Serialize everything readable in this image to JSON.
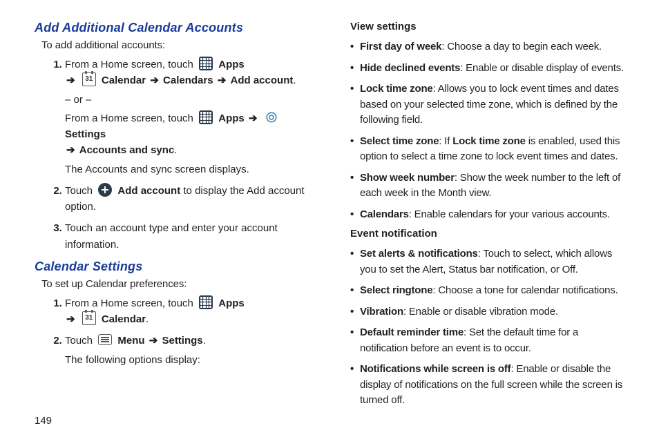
{
  "page_number": "149",
  "left": {
    "section1": {
      "heading": "Add Additional Calendar Accounts",
      "intro": "To add additional accounts:",
      "step1_a": "From a Home screen, touch",
      "apps": "Apps",
      "calendar": "Calendar",
      "calendars": "Calendars",
      "add_account": "Add account",
      "or": "– or –",
      "step1_b": "From a Home screen, touch",
      "settings": "Settings",
      "accounts_sync": "Accounts and sync",
      "step1_c": "The Accounts and sync screen displays.",
      "step2_a": "Touch",
      "step2_b": "Add account",
      "step2_c": " to display the Add account option.",
      "step3": "Touch an account type and enter your account information."
    },
    "section2": {
      "heading": "Calendar Settings",
      "intro": "To set up Calendar preferences:",
      "step1_a": "From a Home screen, touch",
      "apps": "Apps",
      "calendar": "Calendar",
      "step2_a": "Touch",
      "menu": "Menu",
      "settings": "Settings",
      "step2_b": "The following options display:"
    }
  },
  "right": {
    "view_heading": "View settings",
    "items1": [
      {
        "term": "First day of week",
        "desc": ": Choose a day to begin each week."
      },
      {
        "term": "Hide declined events",
        "desc": ": Enable or disable display of events."
      },
      {
        "term": "Lock time zone",
        "desc": ": Allows you to lock event times and dates based on your selected time zone, which is defined by the following field."
      },
      {
        "term": "Select time zone",
        "desc_a": ": If ",
        "term2": "Lock time zone",
        "desc_b": " is enabled, used this option to select a time zone to lock event times and dates."
      },
      {
        "term": "Show week number",
        "desc": ": Show the week number to the left of each week in the Month view."
      },
      {
        "term": "Calendars",
        "desc": ": Enable calendars for your various accounts."
      }
    ],
    "event_heading": "Event notification",
    "items2": [
      {
        "term": "Set alerts & notifications",
        "desc": ": Touch to select, which allows you to set the Alert, Status bar notification, or Off."
      },
      {
        "term": "Select ringtone",
        "desc": ": Choose a tone for calendar notifications."
      },
      {
        "term": "Vibration",
        "desc": ": Enable or disable vibration mode."
      },
      {
        "term": "Default reminder time",
        "desc": ": Set the default time for a notification before an event is to occur."
      },
      {
        "term": "Notifications while screen is off",
        "desc": ": Enable or disable the display of notifications on the full screen while the screen is turned off."
      }
    ]
  },
  "arrow": "➔",
  "cal_day": "31"
}
